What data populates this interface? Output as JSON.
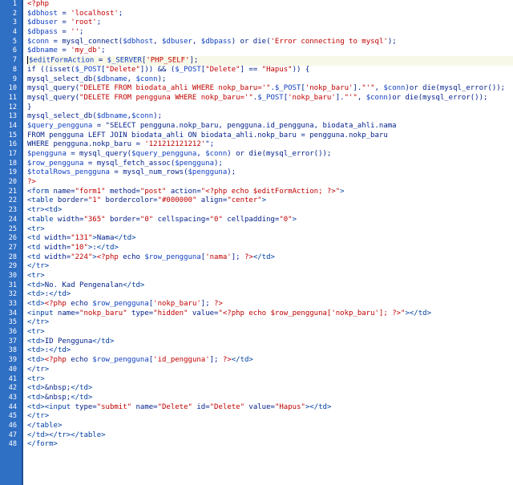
{
  "editor": {
    "lines": [
      "<?php",
      "$dbhost = 'localhost';",
      "$dbuser = 'root';",
      "$dbpass = '';",
      "$conn = mysql_connect($dbhost, $dbuser, $dbpass) or die('Error connecting to mysql');",
      "$dbname = 'my_db';",
      "$editFormAction = $_SERVER['PHP_SELF'];",
      "if ((isset($_POST[\"Delete\"])) && ($_POST[\"Delete\"] == \"Hapus\")) {",
      "mysql_select_db($dbname, $conn);",
      "mysql_query(\"DELETE FROM biodata_ahli WHERE nokp_baru='\".$_POST['nokp_baru'].\"'\", $conn)or die(mysql_error());",
      "mysql_query(\"DELETE FROM pengguna WHERE nokp_baru='\".$_POST['nokp_baru'].\"'\", $conn)or die(mysql_error());",
      "}",
      "mysql_select_db($dbname,$conn);",
      "$query_pengguna = \"SELECT pengguna.nokp_baru, pengguna.id_pengguna, biodata_ahli.nama",
      "FROM pengguna LEFT JOIN biodata_ahli ON biodata_ahli.nokp_baru = pengguna.nokp_baru",
      "WHERE pengguna.nokp_baru = '121212121212'\";",
      "$pengguna = mysql_query($query_pengguna, $conn) or die(mysql_error());",
      "$row_pengguna = mysql_fetch_assoc($pengguna);",
      "$totalRows_pengguna = mysql_num_rows($pengguna);",
      "?>",
      "<form name=\"form1\" method=\"post\" action=\"<?php echo $editFormAction; ?>\">",
      "<table border=\"1\" bordercolor=\"#000000\" align=\"center\">",
      "<tr><td>",
      "<table width=\"365\" border=\"0\" cellspacing=\"0\" cellpadding=\"0\">",
      "<tr>",
      "<td width=\"131\">Nama</td>",
      "<td width=\"10\">:</td>",
      "<td width=\"224\"><?php echo $row_pengguna['nama']; ?></td>",
      "</tr>",
      "<tr>",
      "<td>No. Kad Pengenalan</td>",
      "<td>:</td>",
      "<td><?php echo $row_pengguna['nokp_baru']; ?>",
      "<input name=\"nokp_baru\" type=\"hidden\" value=\"<?php echo $row_pengguna['nokp_baru']; ?>\"></td>",
      "</tr>",
      "<tr>",
      "<td>ID Pengguna</td>",
      "<td>:</td>",
      "<td><?php echo $row_pengguna['id_pengguna']; ?></td>",
      "</tr>",
      "<tr>",
      "<td>&nbsp;</td>",
      "<td>&nbsp;</td>",
      "<td><input type=\"submit\" name=\"Delete\" id=\"Delete\" value=\"Hapus\"></td>",
      "</tr>",
      "</table>",
      "</td></tr></table>",
      "</form>"
    ],
    "line_numbers": [
      "1",
      "2",
      "3",
      "4",
      "5",
      "6",
      "7",
      "8",
      "9",
      "10",
      "11",
      "12",
      "13",
      "14",
      "15",
      "16",
      "17",
      "18",
      "19",
      "20",
      "21",
      "22",
      "23",
      "24",
      "25",
      "26",
      "27",
      "28",
      "29",
      "30",
      "31",
      "32",
      "33",
      "34",
      "35",
      "36",
      "37",
      "38",
      "39",
      "40",
      "41",
      "42",
      "43",
      "44",
      "45",
      "46",
      "47",
      "48"
    ],
    "active_line_index": 6,
    "colors": {
      "gutter": "#2f6fc4",
      "gutter_border": "#1b4f94",
      "php_tag": "#c00000",
      "variable": "#1040c0",
      "string": "#c00000",
      "html_tag": "#0040a0"
    }
  }
}
